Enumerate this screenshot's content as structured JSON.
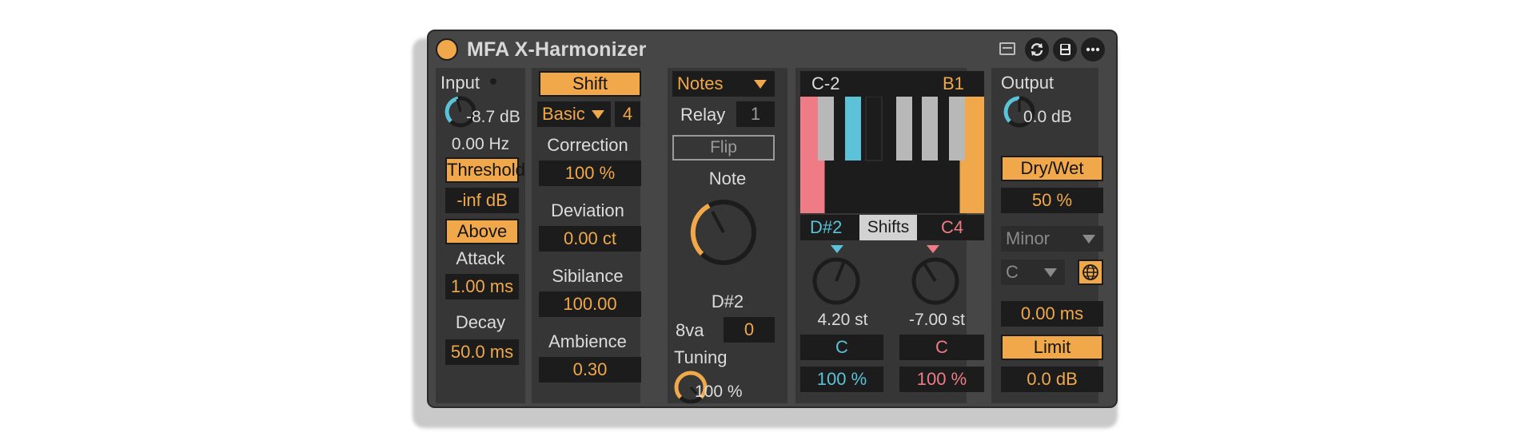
{
  "device": {
    "title": "MFA X-Harmonizer",
    "icons": [
      "record-icon",
      "refresh-icon",
      "save-icon",
      "more-icon"
    ]
  },
  "input": {
    "label": "Input",
    "gain": "-8.7 dB",
    "gain_level": 0.42,
    "frequency": "0.00 Hz",
    "threshold_button": "Threshold",
    "threshold_value": "-inf dB",
    "above_button": "Above",
    "attack_label": "Attack",
    "attack_value": "1.00 ms",
    "decay_label": "Decay",
    "decay_value": "50.0 ms"
  },
  "shift": {
    "shift_button": "Shift",
    "mode": "Basic",
    "mode_amount": "4",
    "correction_label": "Correction",
    "correction_value": "100 %",
    "deviation_label": "Deviation",
    "deviation_value": "0.00 ct",
    "sibilance_label": "Sibilance",
    "sibilance_value": "100.00",
    "ambience_label": "Ambience",
    "ambience_value": "0.30"
  },
  "notes": {
    "source": "Notes",
    "relay_label": "Relay",
    "relay_value": "1",
    "flip_button": "Flip",
    "note_label": "Note",
    "note_value": "D#2",
    "note_level": 0.4,
    "octave_label": "8va",
    "octave_value": "0",
    "tuning_label": "Tuning",
    "tuning_value": "100 %",
    "tuning_level": 1.0
  },
  "shifts": {
    "range_low": "C-2",
    "range_high": "B1",
    "left_note": "D#2",
    "tab_label": "Shifts",
    "right_note": "C4",
    "left_shift": "4.20 st",
    "right_shift": "-7.00 st",
    "left_key": "C",
    "right_key": "C",
    "left_mix": "100 %",
    "right_mix": "100 %",
    "colors": {
      "accent": "#f0a84b",
      "cyan": "#5bc2d8",
      "pink": "#ee7b86"
    }
  },
  "output": {
    "label": "Output",
    "gain": "0.0 dB",
    "gain_level": 0.5,
    "drywet_button": "Dry/Wet",
    "drywet_value": "50 %",
    "scale": "Minor",
    "root": "C",
    "time_value": "0.00 ms",
    "limit_button": "Limit",
    "limit_value": "0.0 dB"
  }
}
